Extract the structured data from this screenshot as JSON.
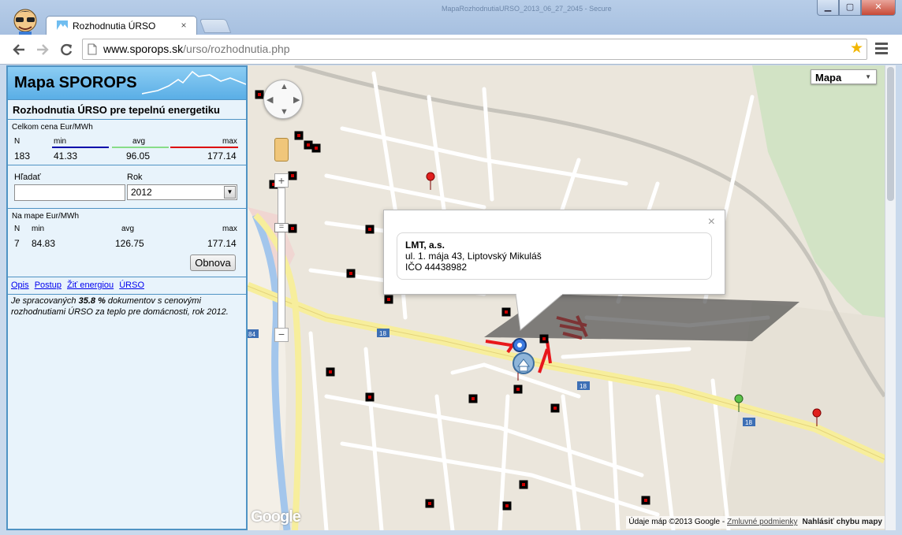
{
  "browser": {
    "window_title": "MapaRozhodnutiaURSO_2013_06_27_2045 - Secure",
    "tab_title": "Rozhodnutia ÚRSO",
    "tab_close": "×",
    "url_host": "www.sporops.sk",
    "url_path": "/urso/rozhodnutia.php"
  },
  "sidebar": {
    "site_title": "Mapa SPOROPS",
    "panel_title": "Rozhodnutia ÚRSO pre tepelnú energetiku",
    "total": {
      "caption": "Celkom cena Eur/MWh",
      "headers": {
        "n": "N",
        "min": "min",
        "avg": "avg",
        "max": "max"
      },
      "values": {
        "n": "183",
        "min": "41.33",
        "avg": "96.05",
        "max": "177.14"
      }
    },
    "search": {
      "label": "Hľadať",
      "value": "",
      "year_label": "Rok",
      "year_value": "2012"
    },
    "map_stats": {
      "caption": "Na mape Eur/MWh",
      "headers": {
        "n": "N",
        "min": "min",
        "avg": "avg",
        "max": "max"
      },
      "values": {
        "n": "7",
        "min": "84.83",
        "avg": "126.75",
        "max": "177.14"
      },
      "refresh_label": "Obnova"
    },
    "links": [
      "Opis",
      "Postup",
      "Žiť energiou",
      "ÚRSO"
    ],
    "note_prefix": "Je spracovaných ",
    "note_percent": "35.8 %",
    "note_suffix": " dokumentov s cenovými rozhodnutiami ÚRSO za teplo pre domácnosti, rok 2012."
  },
  "map": {
    "type_label": "Mapa",
    "info": {
      "name": "LMT, a.s.",
      "address": "ul. 1. mája 43, Liptovský Mikuláš",
      "ico": "IČO 44438982",
      "close": "×"
    },
    "google_logo": "Google",
    "attribution": "Údaje máp ©2013 Google - ",
    "terms_link": "Zmluvné podmienky",
    "report_error": "Nahlásiť chybu mapy",
    "colors": {
      "min_line": "#0000aa",
      "avg_line": "#88dd88",
      "max_line": "#dd0000",
      "marker_red": "#cc0000"
    }
  }
}
